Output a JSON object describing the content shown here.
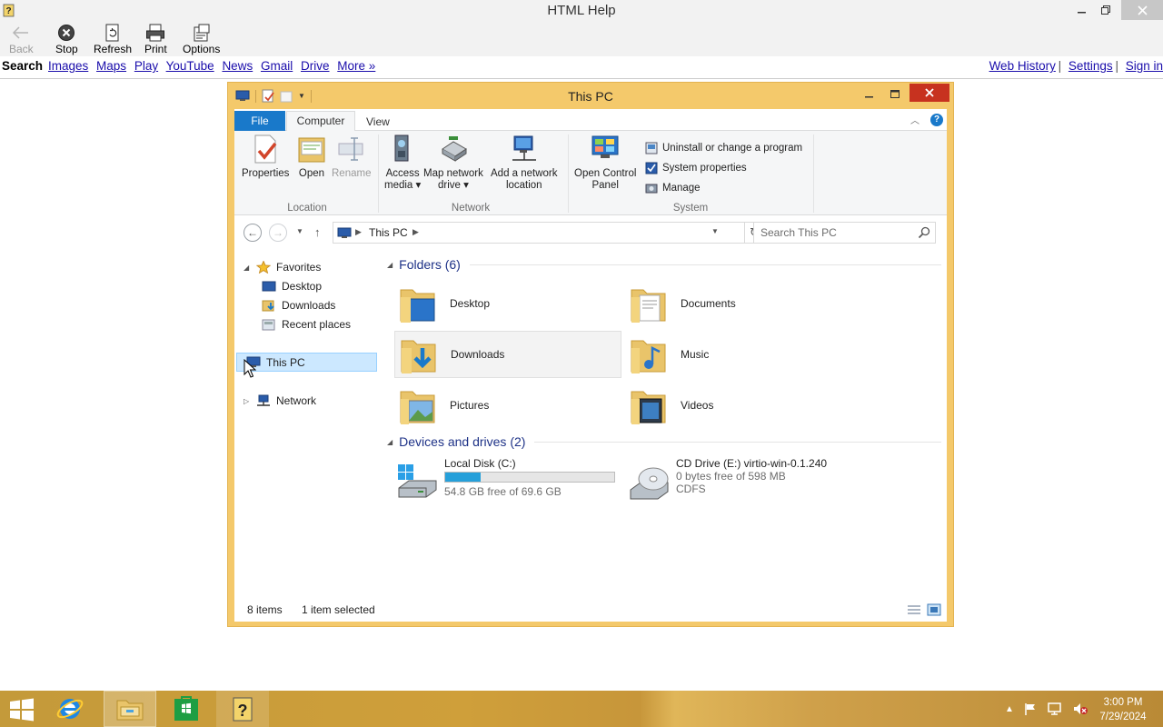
{
  "outer_window": {
    "title": "HTML Help",
    "toolbar": [
      {
        "label": "Back",
        "icon": "back-arrow-icon",
        "enabled": false
      },
      {
        "label": "Stop",
        "icon": "stop-icon",
        "enabled": true
      },
      {
        "label": "Refresh",
        "icon": "refresh-icon",
        "enabled": true
      },
      {
        "label": "Print",
        "icon": "print-icon",
        "enabled": true
      },
      {
        "label": "Options",
        "icon": "options-icon",
        "enabled": true
      }
    ],
    "linkbar": {
      "search_label": "Search",
      "left_links": [
        "Images",
        "Maps",
        "Play",
        "YouTube",
        "News",
        "Gmail",
        "Drive",
        "More »"
      ],
      "right_links": [
        "Web History",
        "Settings",
        "Sign in"
      ],
      "separator": "|"
    }
  },
  "explorer": {
    "title": "This PC",
    "tabs": {
      "file": "File",
      "computer": "Computer",
      "view": "View"
    },
    "ribbon": {
      "location": {
        "label": "Location",
        "properties": "Properties",
        "open": "Open",
        "rename": "Rename"
      },
      "network": {
        "label": "Network",
        "access_media_1": "Access",
        "access_media_2": "media ▾",
        "map_drive_1": "Map network",
        "map_drive_2": "drive ▾",
        "add_location_1": "Add a network",
        "add_location_2": "location"
      },
      "system": {
        "label": "System",
        "control_panel_1": "Open Control",
        "control_panel_2": "Panel",
        "uninstall": "Uninstall or change a program",
        "system_properties": "System properties",
        "manage": "Manage"
      }
    },
    "address": {
      "path": "This PC",
      "search_placeholder": "Search This PC"
    },
    "nav_pane": {
      "favorites": "Favorites",
      "desktop": "Desktop",
      "downloads": "Downloads",
      "recent": "Recent places",
      "this_pc": "This PC",
      "network": "Network"
    },
    "folders_header": "Folders (6)",
    "folders": [
      "Desktop",
      "Documents",
      "Downloads",
      "Music",
      "Pictures",
      "Videos"
    ],
    "selected_folder": "Downloads",
    "devices_header": "Devices and drives (2)",
    "drives": [
      {
        "name": "Local Disk (C:)",
        "free": "54.8 GB free of 69.6 GB",
        "used_fraction": 0.21
      },
      {
        "name": "CD Drive (E:) virtio-win-0.1.240",
        "free": "0 bytes free of 598 MB",
        "fs": "CDFS"
      }
    ],
    "status": {
      "items": "8 items",
      "selected": "1 item selected"
    }
  },
  "taskbar": {
    "time": "3:00 PM",
    "date": "7/29/2024",
    "apps": [
      "internet-explorer-icon",
      "file-explorer-icon",
      "store-icon",
      "html-help-icon"
    ]
  },
  "colors": {
    "explorer_frame": "#f4c96b",
    "file_tab": "#1979ca",
    "selection": "#cce8ff",
    "section_header": "#1e3287",
    "link": "#1a0dab",
    "close_button": "#c7321f"
  }
}
